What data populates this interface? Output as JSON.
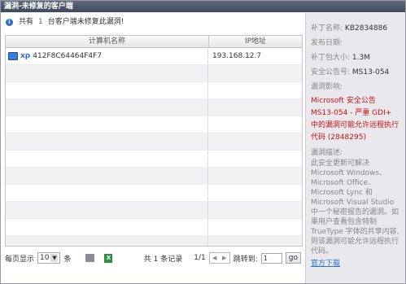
{
  "window": {
    "title": "漏洞-未修复的客户端"
  },
  "summary": {
    "prefix": "共有",
    "count": "1",
    "suffix": "台客户端未修复此漏洞!"
  },
  "grid": {
    "headers": {
      "name": "计算机名称",
      "ip": "IP地址"
    },
    "rows": [
      {
        "os": "xp",
        "name": "412F8C64464F4F7",
        "ip": "193.168.12.7"
      }
    ]
  },
  "pager": {
    "per_page_label": "每页显示",
    "per_page_value": "10",
    "per_page_unit": "条",
    "record_text": "共 1 条记录",
    "page_text": "1/1",
    "jump_label": "跳转到:",
    "jump_value": "1",
    "go_label": "go"
  },
  "detail": {
    "patch_name_label": "补丁名称:",
    "patch_name": "KB2834886",
    "date_label": "发布日期:",
    "date": "",
    "size_label": "补丁包大小:",
    "size": "1.3M",
    "bulletin_label": "安全公告号:",
    "bulletin": "MS13-054",
    "impact_label": "漏洞影响:",
    "impact": "Microsoft 安全公告 MS13-054 - 严重 GDI+ 中的漏洞可能允许远程执行代码 (2848295)",
    "desc_label": "漏洞描述:",
    "desc": "此安全更新可解决 Microsoft Windows、Microsoft Office、Microsoft Lync 和 Microsoft Visual Studio 中一个秘密报告的漏洞。如果用户查看包含特制 TrueType 字体的共享内容,则该漏洞可能允许远程执行代码。",
    "download": "官方下载"
  }
}
